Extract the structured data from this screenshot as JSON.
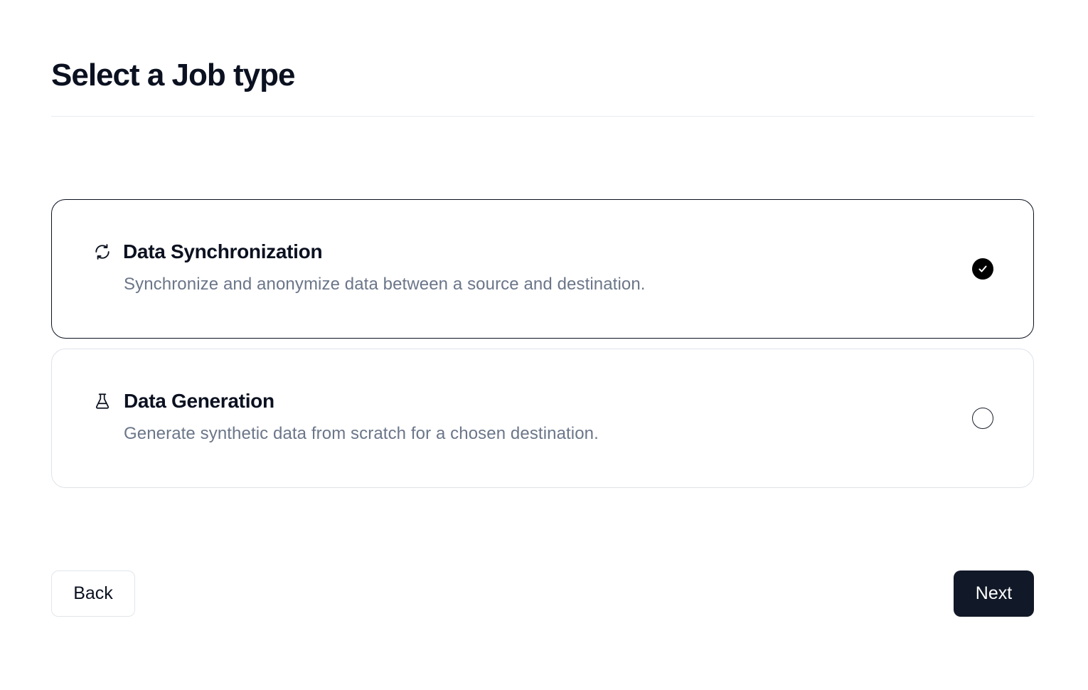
{
  "page": {
    "title": "Select a Job type"
  },
  "options": [
    {
      "icon": "sync-icon",
      "title": "Data Synchronization",
      "description": "Synchronize and anonymize data between a source and destination.",
      "selected": true
    },
    {
      "icon": "flask-icon",
      "title": "Data Generation",
      "description": "Generate synthetic data from scratch for a chosen destination.",
      "selected": false
    }
  ],
  "footer": {
    "back_label": "Back",
    "next_label": "Next"
  },
  "colors": {
    "primary": "#111827",
    "selected_border": "#0b1120",
    "muted_text": "#6b7689",
    "card_border": "#dfe3e8"
  }
}
